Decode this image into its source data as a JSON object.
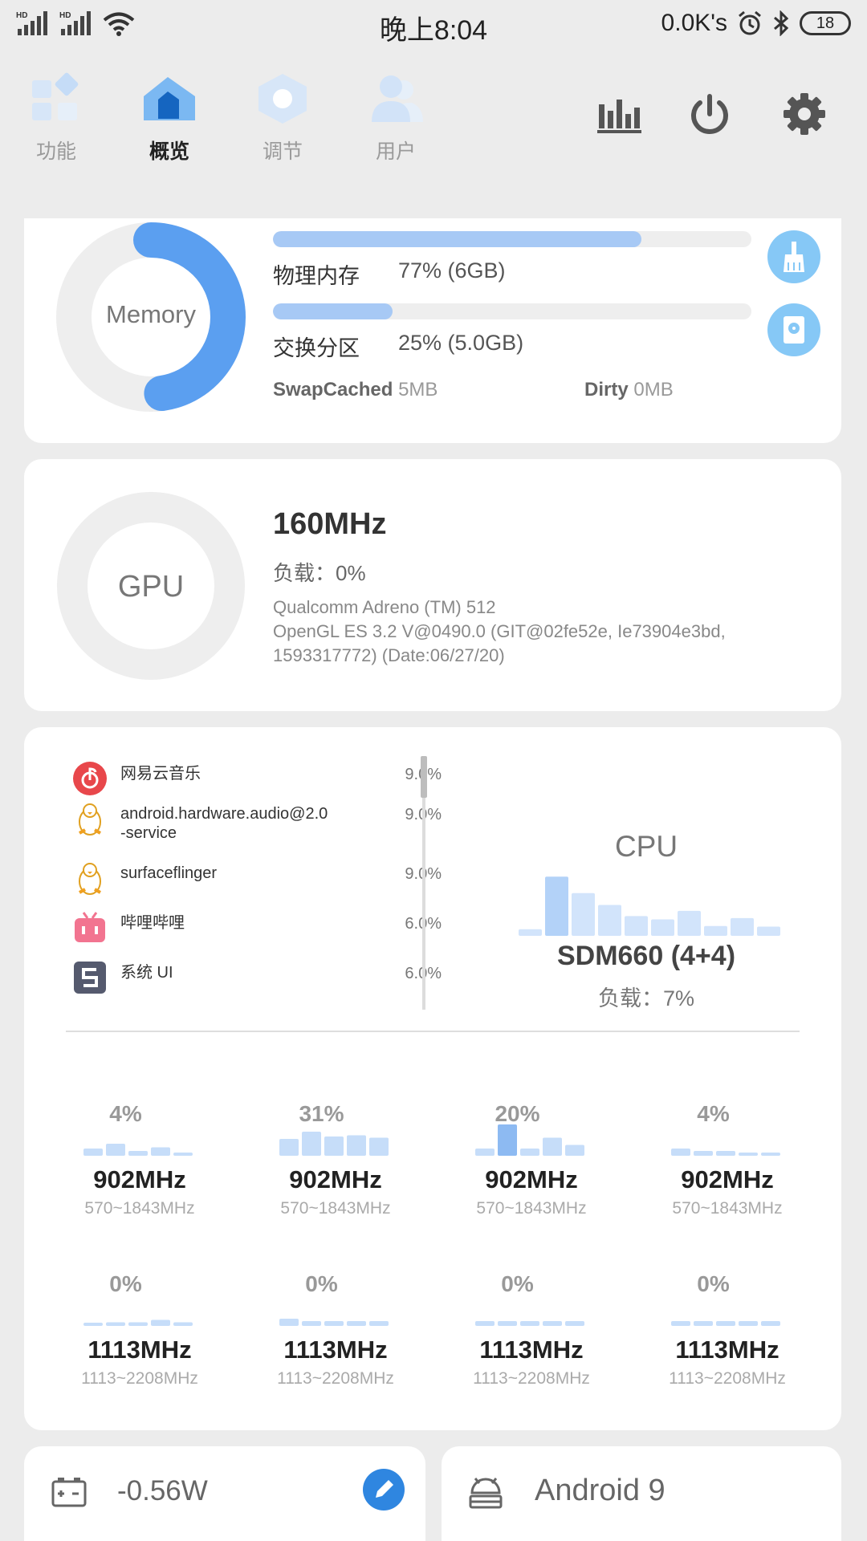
{
  "status_bar": {
    "left_labels": [
      "HD",
      "HD"
    ],
    "time": "晚上8:04",
    "net_speed": "0.0K's",
    "battery": "18"
  },
  "nav": {
    "tabs": [
      {
        "label": "功能",
        "icon": "grid-icon",
        "active": false
      },
      {
        "label": "概览",
        "icon": "home-icon",
        "active": true
      },
      {
        "label": "调节",
        "icon": "hexagon-icon",
        "active": false
      },
      {
        "label": "用户",
        "icon": "users-icon",
        "active": false
      }
    ],
    "tools": [
      "bar-chart-icon",
      "power-icon",
      "gear-icon"
    ]
  },
  "memory": {
    "ring_label": "Memory",
    "ring_percent": 77,
    "physical_label": "物理内存",
    "physical_value": "77% (6GB)",
    "physical_percent": 77,
    "swap_label": "交换分区",
    "swap_value": "25% (5.0GB)",
    "swap_percent": 25,
    "swapcached_key": "SwapCached",
    "swapcached_val": "5MB",
    "dirty_key": "Dirty",
    "dirty_val": "0MB",
    "buttons": [
      "broom-icon",
      "disk-icon"
    ]
  },
  "gpu": {
    "ring_label": "GPU",
    "ring_percent": 0,
    "freq": "160MHz",
    "load": "负载：0%",
    "renderer": "Qualcomm Adreno (TM) 512",
    "version": "OpenGL ES 3.2 V@0490.0 (GIT@02fe52e, Ie73904e3bd,",
    "build": "1593317772) (Date:06/27/20)"
  },
  "processes": [
    {
      "name": "网易云音乐",
      "pct": "9.0%",
      "icon": "netease-music-icon"
    },
    {
      "name": "android.hardware.audio@2.0\n-service",
      "pct": "9.0%",
      "icon": "linux-penguin-icon"
    },
    {
      "name": "surfaceflinger",
      "pct": "9.0%",
      "icon": "linux-penguin-icon"
    },
    {
      "name": "哔哩哔哩",
      "pct": "6.0%",
      "icon": "bilibili-icon"
    },
    {
      "name": "系统 UI",
      "pct": "6.0%",
      "icon": "system-ui-icon"
    }
  ],
  "cpu": {
    "title": "CPU",
    "model": "SDM660 (4+4)",
    "load": "负载：7%",
    "history": [
      0.1,
      0.9,
      0.65,
      0.47,
      0.3,
      0.25,
      0.38,
      0.15,
      0.27,
      0.14
    ]
  },
  "cores": [
    {
      "pct": "4%",
      "freq": "902MHz",
      "range": "570~1843MHz",
      "bars": [
        0.3,
        0.5,
        0.2,
        0.35,
        0.1
      ]
    },
    {
      "pct": "31%",
      "freq": "902MHz",
      "range": "570~1843MHz",
      "bars": [
        0.7,
        1.0,
        0.8,
        0.85,
        0.75
      ]
    },
    {
      "pct": "20%",
      "freq": "902MHz",
      "range": "570~1843MHz",
      "bars": [
        0.3,
        1.3,
        0.3,
        0.75,
        0.45
      ]
    },
    {
      "pct": "4%",
      "freq": "902MHz",
      "range": "570~1843MHz",
      "bars": [
        0.3,
        0.2,
        0.2,
        0.1,
        0.1
      ]
    },
    {
      "pct": "0%",
      "freq": "1113MHz",
      "range": "1113~2208MHz",
      "bars": [
        0.05,
        0.15,
        0.15,
        0.25,
        0.15
      ]
    },
    {
      "pct": "0%",
      "freq": "1113MHz",
      "range": "1113~2208MHz",
      "bars": [
        0.3,
        0.2,
        0.2,
        0.2,
        0.2
      ]
    },
    {
      "pct": "0%",
      "freq": "1113MHz",
      "range": "1113~2208MHz",
      "bars": [
        0.2,
        0.2,
        0.2,
        0.2,
        0.2
      ]
    },
    {
      "pct": "0%",
      "freq": "1113MHz",
      "range": "1113~2208MHz",
      "bars": [
        0.2,
        0.2,
        0.2,
        0.2,
        0.2
      ]
    }
  ],
  "power": {
    "value": "-0.56W",
    "icon": "battery-charge-icon",
    "edit_icon": "pencil-icon"
  },
  "android": {
    "version": "Android 9",
    "icon": "android-icon"
  },
  "colors": {
    "accent": "#5b9ff0",
    "accent_light": "#a7c9f5",
    "bg": "#ececec",
    "card": "#ffffff"
  }
}
